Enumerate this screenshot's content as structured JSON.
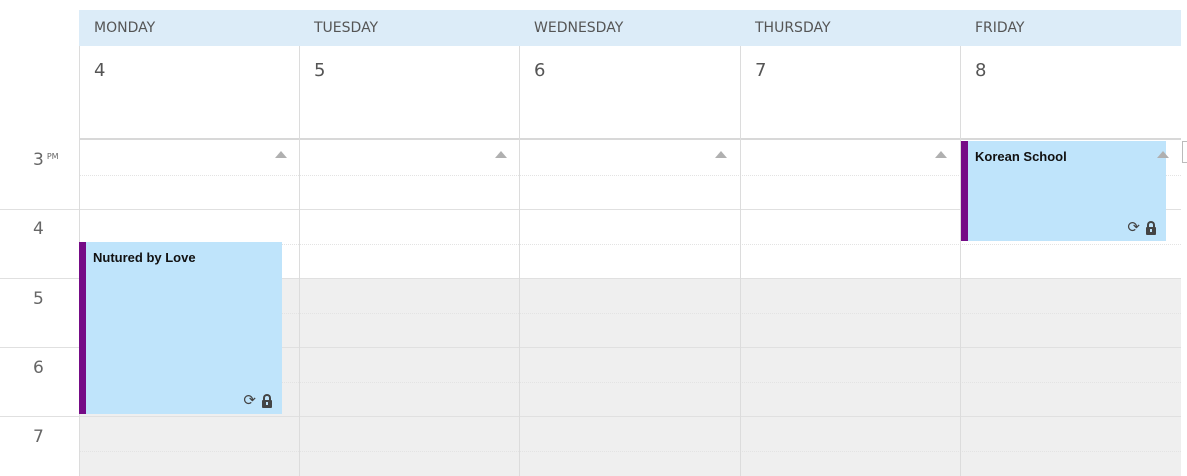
{
  "days": [
    {
      "name": "MONDAY",
      "date": "4"
    },
    {
      "name": "TUESDAY",
      "date": "5"
    },
    {
      "name": "WEDNESDAY",
      "date": "6"
    },
    {
      "name": "THURSDAY",
      "date": "7"
    },
    {
      "name": "FRIDAY",
      "date": "8"
    }
  ],
  "hours": [
    {
      "label": "3",
      "ampm": "PM"
    },
    {
      "label": "4",
      "ampm": ""
    },
    {
      "label": "5",
      "ampm": ""
    },
    {
      "label": "6",
      "ampm": ""
    },
    {
      "label": "7",
      "ampm": ""
    }
  ],
  "events": [
    {
      "title": "Korean School",
      "day": "FRIDAY",
      "icons": [
        "recurring-icon",
        "private-lock-icon"
      ],
      "color": "#bfe4fb",
      "accent": "#750b86"
    },
    {
      "title": "Nutured by Love",
      "day": "MONDAY",
      "icons": [
        "recurring-icon",
        "private-lock-icon"
      ],
      "color": "#bfe4fb",
      "accent": "#750b86"
    }
  ],
  "colors": {
    "header_bg": "#dcecf8",
    "nonwork_bg": "#efefef",
    "event_bg": "#bfe4fb",
    "event_accent": "#750b86"
  }
}
